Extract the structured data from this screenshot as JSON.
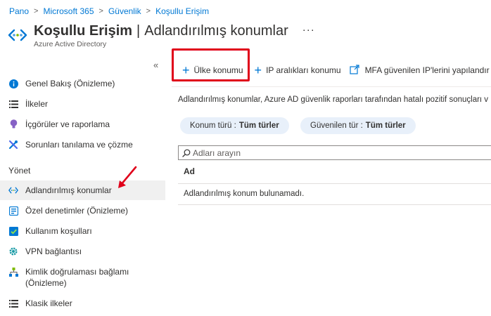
{
  "breadcrumb": [
    "Pano",
    "Microsoft 365",
    "Güvenlik",
    "Koşullu Erişim"
  ],
  "header": {
    "title": "Koşullu Erişim",
    "separator": "|",
    "page": "Adlandırılmış konumlar",
    "more": "···",
    "subtitle": "Azure Active Directory"
  },
  "sidebar": {
    "collapse": "«",
    "items": [
      {
        "label": "Genel Bakış (Önizleme)",
        "icon": "info-icon"
      },
      {
        "label": "İlkeler",
        "icon": "list-icon"
      },
      {
        "label": "İçgörüler ve raporlama",
        "icon": "lightbulb-icon"
      },
      {
        "label": "Sorunları tanılama ve çözme",
        "icon": "tools-icon"
      }
    ],
    "section": "Yönet",
    "manage_items": [
      {
        "label": "Adlandırılmış konumlar",
        "icon": "named-locations-icon",
        "active": true
      },
      {
        "label": "Özel denetimler (Önizleme)",
        "icon": "custom-controls-icon"
      },
      {
        "label": "Kullanım koşulları",
        "icon": "checkbox-icon"
      },
      {
        "label": "VPN bağlantısı",
        "icon": "vpn-gear-icon"
      },
      {
        "label": "Kimlik doğrulaması bağlamı",
        "label2": "(Önizleme)",
        "icon": "hierarchy-icon"
      },
      {
        "label": "Klasik ilkeler",
        "icon": "list-icon"
      }
    ]
  },
  "toolbar": {
    "country_location": "Ülke konumu",
    "ip_ranges_location": "IP aralıkları konumu",
    "mfa_trusted_ips": "MFA güvenilen IP'lerini yapılandır"
  },
  "description": "Adlandırılmış konumlar, Azure AD güvenlik raporları tarafından hatalı pozitif sonuçları v",
  "filters": {
    "location_type_label": "Konum türü :",
    "location_type_value": "Tüm türler",
    "trusted_type_label": "Güvenilen tür :",
    "trusted_type_value": "Tüm türler"
  },
  "search": {
    "placeholder": "Adları arayın"
  },
  "table": {
    "column": "Ad",
    "empty_message": "Adlandırılmış konum bulunamadı."
  },
  "colors": {
    "accent": "#0078d4",
    "highlight": "#e0001a",
    "pill": "#e8f0fa"
  }
}
